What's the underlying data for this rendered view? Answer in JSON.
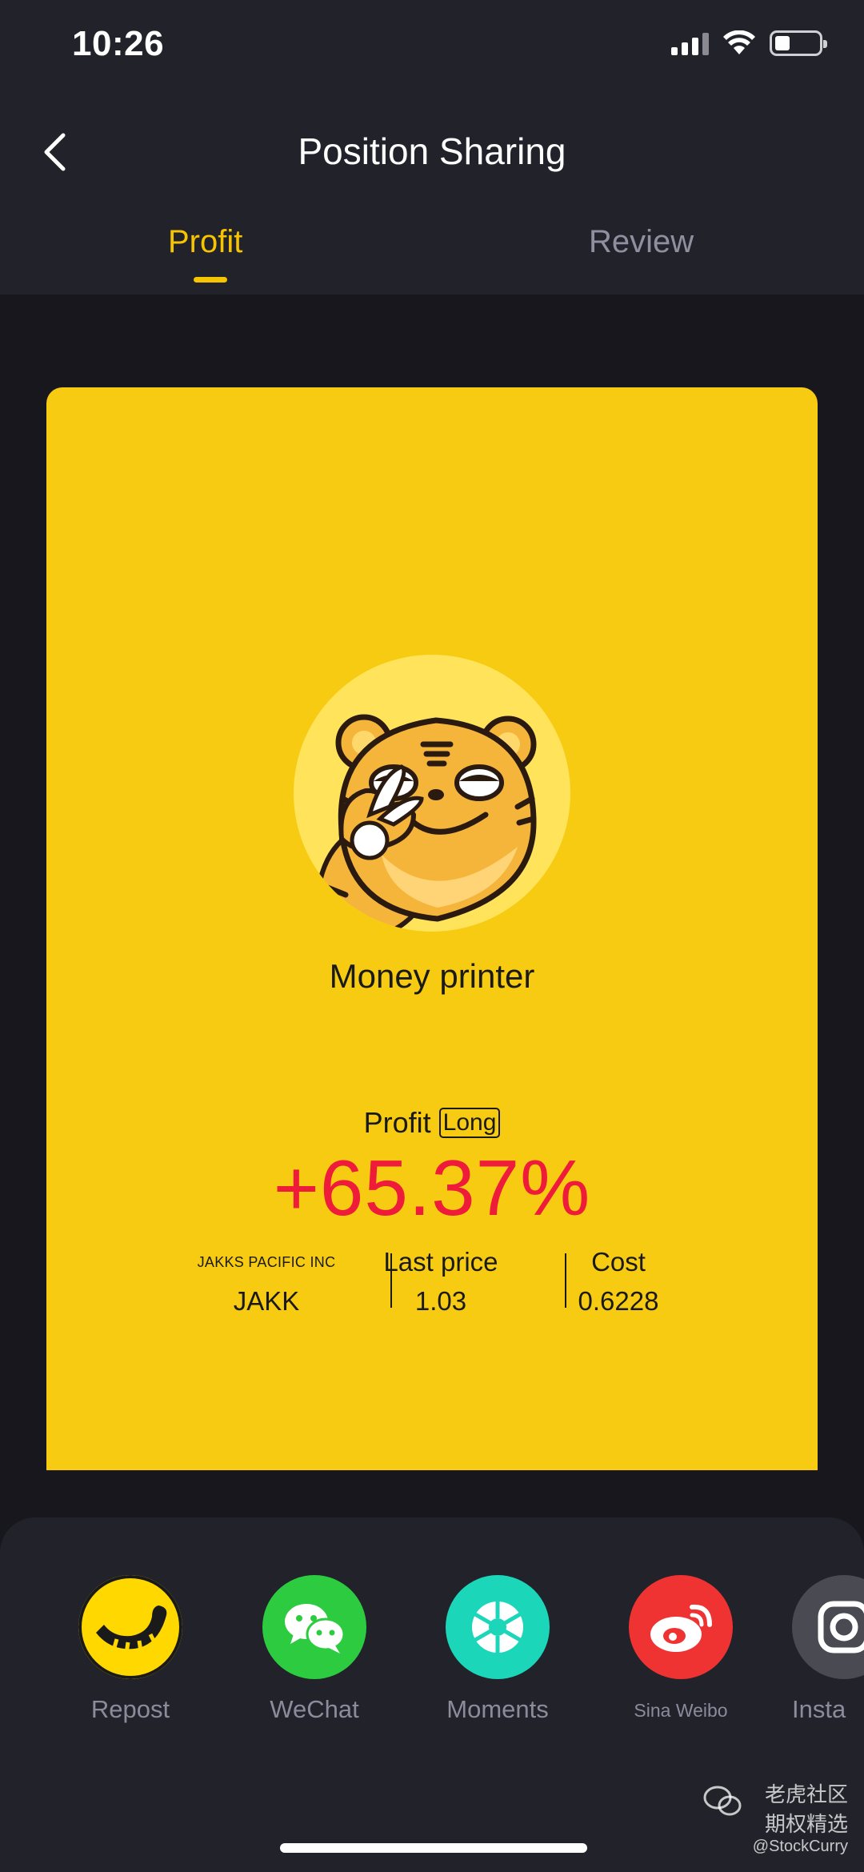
{
  "status_bar": {
    "time": "10:26"
  },
  "header": {
    "title": "Position Sharing"
  },
  "tabs": [
    {
      "label": "Profit",
      "active": true
    },
    {
      "label": "Review",
      "active": false
    }
  ],
  "card": {
    "nickname": "Money printer",
    "profit_label": "Profit",
    "position_tag": "Long",
    "profit_value": "+65.37%",
    "stats": [
      {
        "label": "JAKKS PACIFIC INC",
        "value": "JAKK"
      },
      {
        "label": "Last price",
        "value": "1.03"
      },
      {
        "label": "Cost",
        "value": "0.6228"
      }
    ]
  },
  "share_targets": [
    {
      "label": "Repost",
      "icon": "tiger-tail-icon",
      "color": "#ffd800"
    },
    {
      "label": "WeChat",
      "icon": "wechat-icon",
      "color": "#2dcc40"
    },
    {
      "label": "Moments",
      "icon": "moments-icon",
      "color": "#1bd6b8"
    },
    {
      "label": "Sina Weibo",
      "icon": "weibo-icon",
      "color": "#ef3333"
    },
    {
      "label": "Insta",
      "icon": "instagram-icon",
      "color": "#4a4a52"
    }
  ],
  "watermark": {
    "line1": "老虎社区",
    "line2": "期权精选",
    "line3": "@StockCurry"
  },
  "colors": {
    "accent": "#f6c400",
    "profit": "#ee1c3a",
    "card": "#f7cb12",
    "background": "#17171d"
  }
}
